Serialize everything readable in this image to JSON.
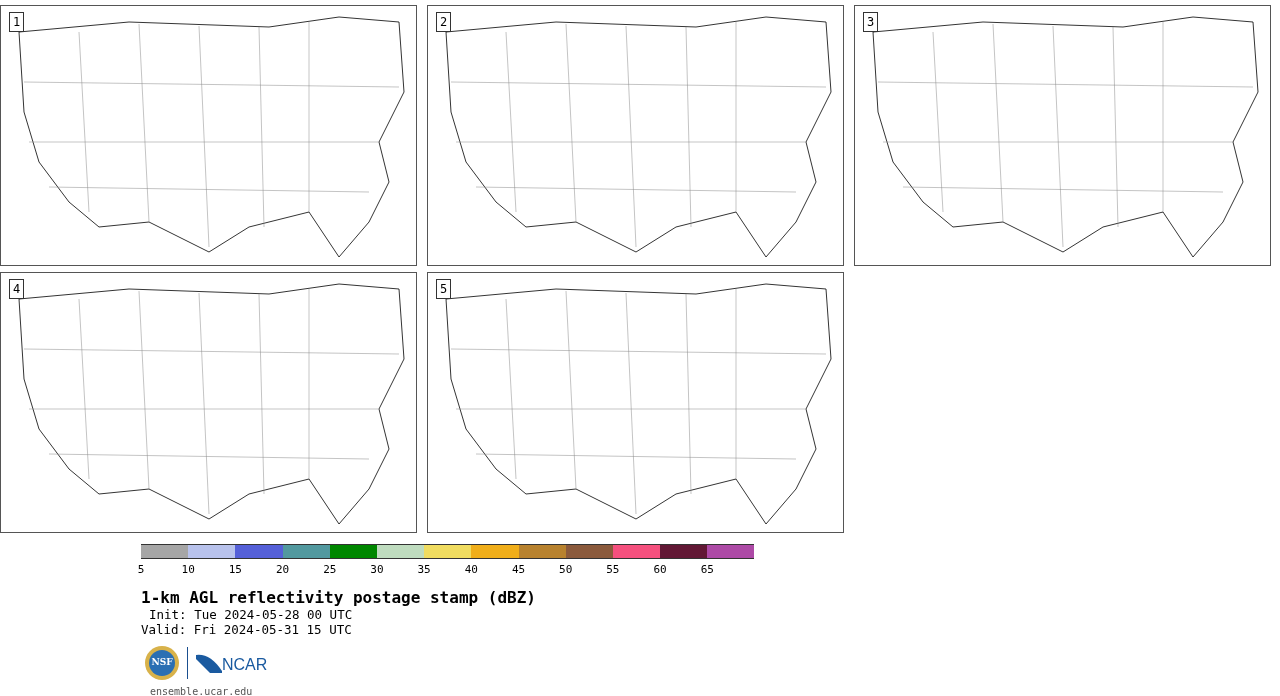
{
  "panels": [
    {
      "label": "1"
    },
    {
      "label": "2"
    },
    {
      "label": "3"
    },
    {
      "label": "4"
    },
    {
      "label": "5"
    }
  ],
  "colorbar": {
    "segments": [
      {
        "label": "5",
        "color": "#a6a6a6"
      },
      {
        "label": "10",
        "color": "#b8c2ec"
      },
      {
        "label": "15",
        "color": "#5560d8"
      },
      {
        "label": "20",
        "color": "#52999f"
      },
      {
        "label": "25",
        "color": "#008700"
      },
      {
        "label": "30",
        "color": "#bfdcbf"
      },
      {
        "label": "35",
        "color": "#f0dc60"
      },
      {
        "label": "40",
        "color": "#f0ae1a"
      },
      {
        "label": "45",
        "color": "#b8822e"
      },
      {
        "label": "50",
        "color": "#8b5a3c"
      },
      {
        "label": "55",
        "color": "#f5507e"
      },
      {
        "label": "60",
        "color": "#621835"
      },
      {
        "label": "65",
        "color": "#ad4aa6"
      }
    ]
  },
  "title": "1-km AGL reflectivity postage stamp (dBZ)",
  "init": "Init: Tue 2024-05-28 00 UTC",
  "valid": "Valid: Fri 2024-05-31 15 UTC",
  "logos": {
    "nsf": "NSF",
    "ncar": "NCAR"
  },
  "footer": "ensemble.ucar.edu"
}
